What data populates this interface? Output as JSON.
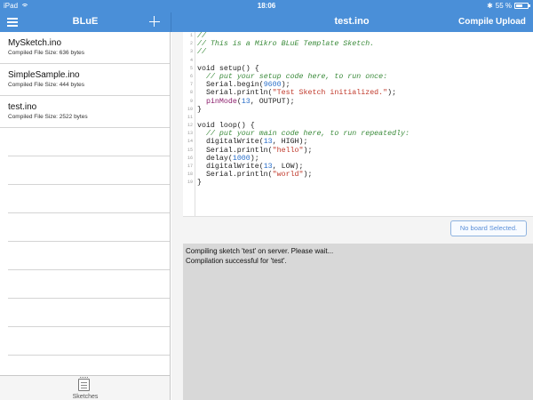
{
  "status_bar": {
    "carrier": "iPad",
    "time": "18:06",
    "battery_text": "55 %",
    "battery_level": 0.55
  },
  "nav": {
    "left_title": "BLuE",
    "right_title": "test.ino",
    "compile_label": "Compile",
    "upload_label": "Upload"
  },
  "sketches": [
    {
      "name": "MySketch.ino",
      "size": "Compiled File Size: 636 bytes"
    },
    {
      "name": "SimpleSample.ino",
      "size": "Compiled File Size: 444 bytes"
    },
    {
      "name": "test.ino",
      "size": "Compiled File Size: 2522 bytes"
    }
  ],
  "tabbar": {
    "sketches_label": "Sketches"
  },
  "editor": {
    "lines": [
      {
        "n": "1",
        "html": "<span class=\"c-com\">//</span>"
      },
      {
        "n": "2",
        "html": "<span class=\"c-com\">// This is a Mikro BLuE Template Sketch.</span>"
      },
      {
        "n": "3",
        "html": "<span class=\"c-com\">//</span>"
      },
      {
        "n": "4",
        "html": ""
      },
      {
        "n": "5",
        "html": "void setup() {"
      },
      {
        "n": "6",
        "html": "  <span class=\"c-com\">// put your setup code here, to run once:</span>"
      },
      {
        "n": "7",
        "html": "  Serial.begin(<span class=\"c-num\">9600</span>);"
      },
      {
        "n": "8",
        "html": "  Serial.println(<span class=\"c-str\">\"Test Sketch initialized.\"</span>);"
      },
      {
        "n": "9",
        "html": "  <span class=\"c-kw\">pinMode</span>(<span class=\"c-num\">13</span>, OUTPUT);"
      },
      {
        "n": "10",
        "html": "}"
      },
      {
        "n": "11",
        "html": ""
      },
      {
        "n": "12",
        "html": "void loop() {"
      },
      {
        "n": "13",
        "html": "  <span class=\"c-com\">// put your main code here, to run repeatedly:</span>"
      },
      {
        "n": "14",
        "html": "  digitalWrite(<span class=\"c-num\">13</span>, HIGH);"
      },
      {
        "n": "15",
        "html": "  Serial.println(<span class=\"c-str\">\"hello\"</span>);"
      },
      {
        "n": "16",
        "html": "  delay(<span class=\"c-num\">1000</span>);"
      },
      {
        "n": "17",
        "html": "  digitalWrite(<span class=\"c-num\">13</span>, LOW);"
      },
      {
        "n": "18",
        "html": "  Serial.println(<span class=\"c-str\">\"world\"</span>);"
      },
      {
        "n": "19",
        "html": "}"
      }
    ]
  },
  "board_button_label": "No board Selected.",
  "console": {
    "lines": [
      "Compiling sketch 'test' on server. Please wait...",
      "Compilation successful for 'test'."
    ]
  }
}
